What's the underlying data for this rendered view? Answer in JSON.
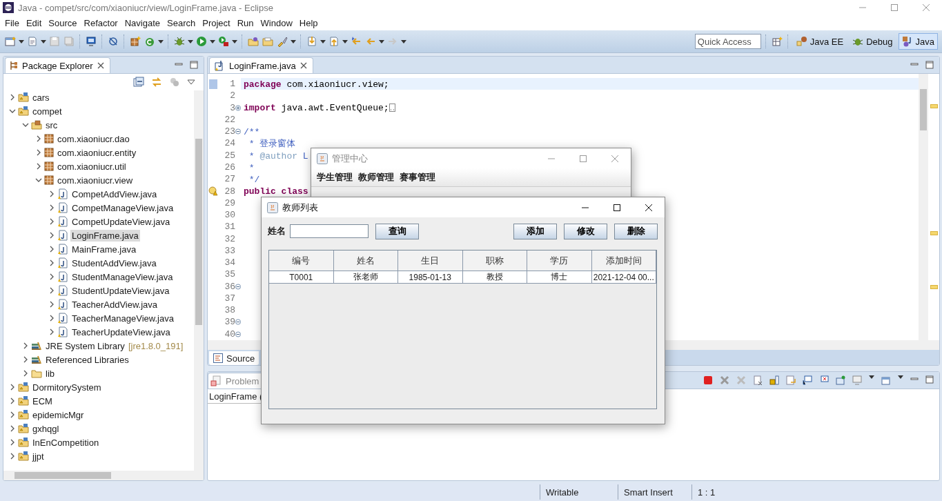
{
  "window": {
    "title": "Java - compet/src/com/xiaoniucr/view/LoginFrame.java - Eclipse"
  },
  "menu": [
    "File",
    "Edit",
    "Source",
    "Refactor",
    "Navigate",
    "Search",
    "Project",
    "Run",
    "Window",
    "Help"
  ],
  "quick_access": {
    "placeholder": "Quick Access"
  },
  "perspectives": [
    {
      "label": "Java EE",
      "selected": false
    },
    {
      "label": "Debug",
      "selected": false
    },
    {
      "label": "Java",
      "selected": true
    }
  ],
  "package_explorer": {
    "title": "Package Explorer",
    "tree": [
      {
        "label": "cars",
        "kind": "project",
        "expanded": false,
        "selected": false
      },
      {
        "label": "compet",
        "kind": "project",
        "expanded": true,
        "selected": false,
        "children": [
          {
            "label": "src",
            "kind": "source",
            "expanded": true,
            "selected": false,
            "children": [
              {
                "label": "com.xiaoniucr.dao",
                "kind": "package",
                "expanded": false,
                "selected": false
              },
              {
                "label": "com.xiaoniucr.entity",
                "kind": "package",
                "expanded": false,
                "selected": false
              },
              {
                "label": "com.xiaoniucr.util",
                "kind": "package",
                "expanded": false,
                "selected": false
              },
              {
                "label": "com.xiaoniucr.view",
                "kind": "package",
                "expanded": true,
                "selected": false,
                "children": [
                  {
                    "label": "CompetAddView.java",
                    "kind": "java",
                    "expanded": false,
                    "selected": false
                  },
                  {
                    "label": "CompetManageView.java",
                    "kind": "java",
                    "expanded": false,
                    "selected": false
                  },
                  {
                    "label": "CompetUpdateView.java",
                    "kind": "java",
                    "expanded": false,
                    "selected": false
                  },
                  {
                    "label": "LoginFrame.java",
                    "kind": "java",
                    "expanded": false,
                    "selected": true
                  },
                  {
                    "label": "MainFrame.java",
                    "kind": "java",
                    "expanded": false,
                    "selected": false
                  },
                  {
                    "label": "StudentAddView.java",
                    "kind": "java",
                    "expanded": false,
                    "selected": false
                  },
                  {
                    "label": "StudentManageView.java",
                    "kind": "java",
                    "expanded": false,
                    "selected": false
                  },
                  {
                    "label": "StudentUpdateView.java",
                    "kind": "java",
                    "expanded": false,
                    "selected": false
                  },
                  {
                    "label": "TeacherAddView.java",
                    "kind": "java",
                    "expanded": false,
                    "selected": false
                  },
                  {
                    "label": "TeacherManageView.java",
                    "kind": "java",
                    "expanded": false,
                    "selected": false
                  },
                  {
                    "label": "TeacherUpdateView.java",
                    "kind": "java",
                    "expanded": false,
                    "selected": false
                  }
                ]
              }
            ]
          },
          {
            "label": "JRE System Library",
            "decoration": "[jre1.8.0_191]",
            "kind": "library",
            "expanded": false,
            "selected": false
          },
          {
            "label": "Referenced Libraries",
            "kind": "library",
            "expanded": false,
            "selected": false
          },
          {
            "label": "lib",
            "kind": "folder",
            "expanded": false,
            "selected": false
          }
        ]
      },
      {
        "label": "DormitorySystem",
        "kind": "project",
        "expanded": false,
        "selected": false
      },
      {
        "label": "ECM",
        "kind": "project",
        "expanded": false,
        "selected": false
      },
      {
        "label": "epidemicMgr",
        "kind": "project",
        "expanded": false,
        "selected": false
      },
      {
        "label": "gxhqgl",
        "kind": "project",
        "expanded": false,
        "selected": false
      },
      {
        "label": "InEnCompetition",
        "kind": "project",
        "expanded": false,
        "selected": false
      },
      {
        "label": "jjpt",
        "kind": "project",
        "expanded": false,
        "selected": false
      }
    ]
  },
  "editor": {
    "tab": "LoginFrame.java",
    "lines": [
      {
        "number": "1",
        "current": true,
        "changed": true,
        "parts": [
          {
            "kind": "keyword",
            "text": "package"
          },
          {
            "kind": "plain",
            "text": " com.xiaoniucr.view;"
          }
        ]
      },
      {
        "number": "2",
        "current": false
      },
      {
        "number": "3",
        "current": false,
        "foldable": true,
        "collapsed": true,
        "parts": [
          {
            "kind": "keyword",
            "text": "import"
          },
          {
            "kind": "plain",
            "text": " java.awt.EventQueue;"
          }
        ]
      },
      {
        "number": "22",
        "current": false
      },
      {
        "number": "23",
        "current": false,
        "foldable": true,
        "collapsed": false,
        "parts": [
          {
            "kind": "comment",
            "text": "/**"
          }
        ]
      },
      {
        "number": "24",
        "current": false,
        "parts": [
          {
            "kind": "comment",
            "text": " * 登录窗体"
          }
        ]
      },
      {
        "number": "25",
        "current": false,
        "parts": [
          {
            "kind": "comment",
            "text": " * "
          },
          {
            "kind": "tag",
            "text": "@author"
          },
          {
            "kind": "comment",
            "text": " L"
          }
        ]
      },
      {
        "number": "26",
        "current": false,
        "parts": [
          {
            "kind": "comment",
            "text": " *"
          }
        ]
      },
      {
        "number": "27",
        "current": false,
        "parts": [
          {
            "kind": "comment",
            "text": " */"
          }
        ]
      },
      {
        "number": "28",
        "current": false,
        "warning": true,
        "parts": [
          {
            "kind": "keyword",
            "text": "public class"
          }
        ]
      },
      {
        "number": "29",
        "current": false
      },
      {
        "number": "30",
        "current": false
      },
      {
        "number": "31",
        "current": false
      },
      {
        "number": "32",
        "current": false
      },
      {
        "number": "33",
        "current": false
      },
      {
        "number": "34",
        "current": false
      },
      {
        "number": "35",
        "current": false
      },
      {
        "number": "36",
        "current": false,
        "foldable": true,
        "collapsed": false
      },
      {
        "number": "37",
        "current": false
      },
      {
        "number": "38",
        "current": false
      },
      {
        "number": "39",
        "current": false,
        "foldable": true,
        "collapsed": false
      },
      {
        "number": "40",
        "current": false,
        "foldable": true,
        "collapsed": false
      }
    ],
    "bottom_tabs": [
      {
        "label": "Source",
        "selected": true
      }
    ]
  },
  "problems": {
    "tab": "Problem",
    "row": "LoginFrame ("
  },
  "status_bar": [
    "Writable",
    "Smart Insert",
    "1 : 1"
  ],
  "main_window": {
    "title": "管理中心",
    "menu": [
      "学生管理",
      "教师管理",
      "赛事管理"
    ]
  },
  "dialog": {
    "title": "教师列表",
    "search_label": "姓名",
    "search_button": "查询",
    "buttons": [
      "添加",
      "修改",
      "删除"
    ],
    "columns": [
      "编号",
      "姓名",
      "生日",
      "职称",
      "学历",
      "添加时间"
    ],
    "rows": [
      [
        "T0001",
        "张老师",
        "1985-01-13",
        "教授",
        "博士",
        "2021-12-04 00..."
      ]
    ]
  }
}
